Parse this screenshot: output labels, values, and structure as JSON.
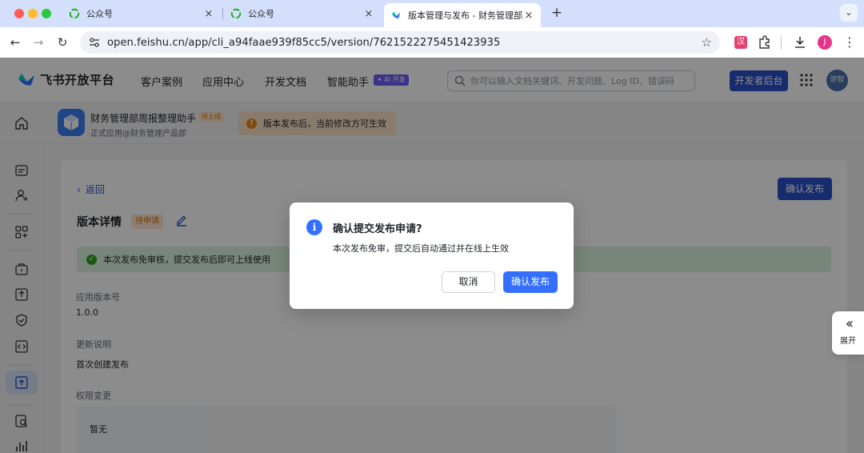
{
  "browser": {
    "tabs": [
      {
        "title": "公众号"
      },
      {
        "title": "公众号"
      },
      {
        "title": "版本管理与发布 - 财务管理部周"
      }
    ],
    "new_tab": "+",
    "url": "open.feishu.cn/app/cli_a94faae939f85cc5/version/7621522275451423935",
    "profile_initial": "J",
    "extension_label": "汉"
  },
  "header": {
    "brand": "飞书开放平台",
    "nav": [
      "客户案例",
      "应用中心",
      "开发文档",
      "智能助手"
    ],
    "ai_badge": "✦ AI 开发",
    "search_placeholder": "你可以输入文档关键词、开发问题、Log ID、错误码",
    "dev_console": "开发者后台",
    "avatar_text": "骄智"
  },
  "app": {
    "name": "财务管理部周报整理助手",
    "status": "待上线",
    "subtitle": "正式应用@财务管理产品部",
    "notice": "版本发布后，当前修改方可生效"
  },
  "content": {
    "back": "返回",
    "confirm_publish": "确认发布",
    "title": "版本详情",
    "status_tag": "待申请",
    "success_notice": "本次发布免审核，提交发布后即可上线使用",
    "fields": [
      {
        "label": "应用版本号",
        "value": "1.0.0"
      },
      {
        "label": "更新说明",
        "value": "首次创建发布"
      }
    ],
    "permission_label": "权限变更",
    "permission_value": "暂无"
  },
  "expand": {
    "label": "展开"
  },
  "dialog": {
    "title": "确认提交发布申请?",
    "body": "本次发布免审，提交后自动通过并在线上生效",
    "cancel": "取消",
    "confirm": "确认发布"
  },
  "colors": {
    "primary": "#2a50c9",
    "dialog_primary": "#3370ff",
    "warning": "#de7802",
    "success": "#2ea121"
  }
}
